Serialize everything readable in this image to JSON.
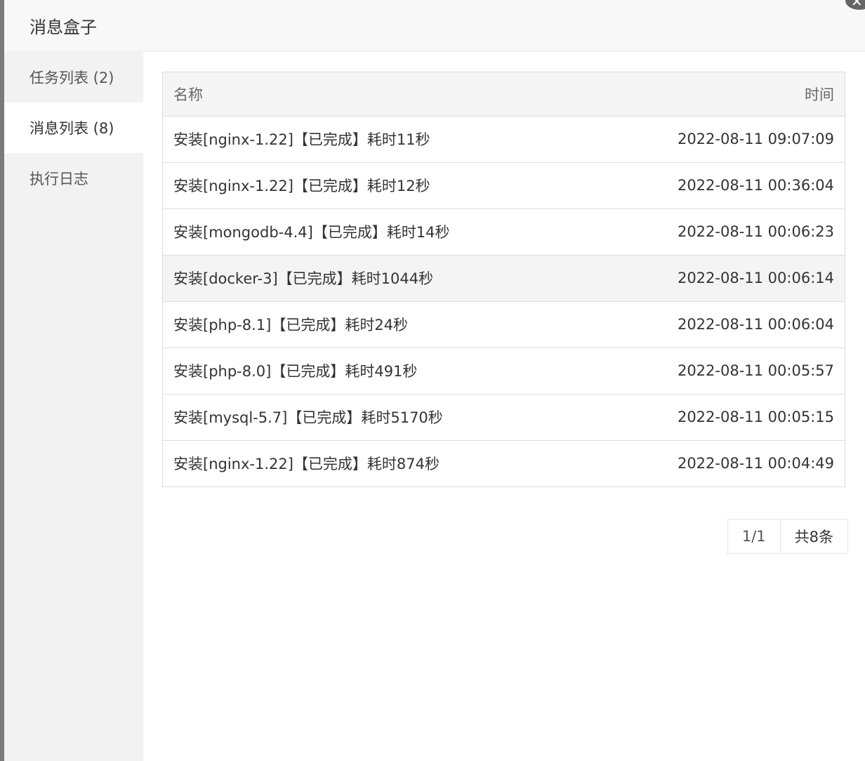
{
  "dialog": {
    "title": "消息盒子",
    "close_icon": "close-icon"
  },
  "sidebar": {
    "items": [
      {
        "label": "任务列表 (2)"
      },
      {
        "label": "消息列表 (8)"
      },
      {
        "label": "执行日志"
      }
    ],
    "active_index": 1
  },
  "table": {
    "headers": {
      "name": "名称",
      "time": "时间"
    },
    "rows": [
      {
        "name": "安装[nginx-1.22]【已完成】耗时11秒",
        "time": "2022-08-11 09:07:09"
      },
      {
        "name": "安装[nginx-1.22]【已完成】耗时12秒",
        "time": "2022-08-11 00:36:04"
      },
      {
        "name": "安装[mongodb-4.4]【已完成】耗时14秒",
        "time": "2022-08-11 00:06:23"
      },
      {
        "name": "安装[docker-3]【已完成】耗时1044秒",
        "time": "2022-08-11 00:06:14"
      },
      {
        "name": "安装[php-8.1]【已完成】耗时24秒",
        "time": "2022-08-11 00:06:04"
      },
      {
        "name": "安装[php-8.0]【已完成】耗时491秒",
        "time": "2022-08-11 00:05:57"
      },
      {
        "name": "安装[mysql-5.7]【已完成】耗时5170秒",
        "time": "2022-08-11 00:05:15"
      },
      {
        "name": "安装[nginx-1.22]【已完成】耗时874秒",
        "time": "2022-08-11 00:04:49"
      }
    ]
  },
  "pager": {
    "page": "1/1",
    "total": "共8条"
  }
}
